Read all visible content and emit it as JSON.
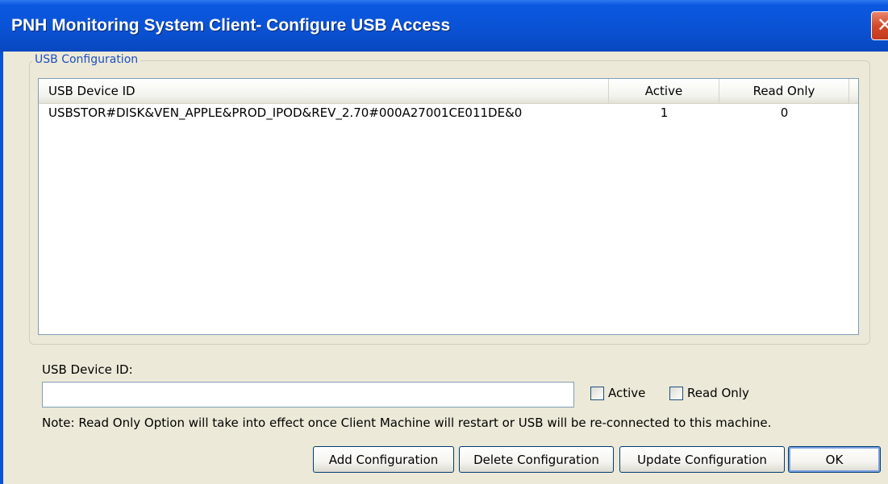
{
  "window": {
    "title": "PNH Monitoring System Client- Configure USB Access",
    "close_glyph": "✕"
  },
  "group": {
    "title": "USB Configuration"
  },
  "table": {
    "columns": [
      "USB Device ID",
      "Active",
      "Read Only"
    ],
    "rows": [
      {
        "device_id": "USBSTOR#DISK&VEN_APPLE&PROD_IPOD&REV_2.70#000A27001CE011DE&0",
        "active": "1",
        "read_only": "0"
      }
    ]
  },
  "form": {
    "device_id_label": "USB Device ID:",
    "device_id_value": "",
    "active_label": "Active",
    "active_checked": false,
    "read_only_label": "Read Only",
    "read_only_checked": false,
    "note": "Note: Read Only Option will take into effect once Client Machine will restart or USB will be re-connected to this machine."
  },
  "buttons": {
    "add": "Add Configuration",
    "delete": "Delete Configuration",
    "update": "Update Configuration",
    "ok": "OK"
  }
}
